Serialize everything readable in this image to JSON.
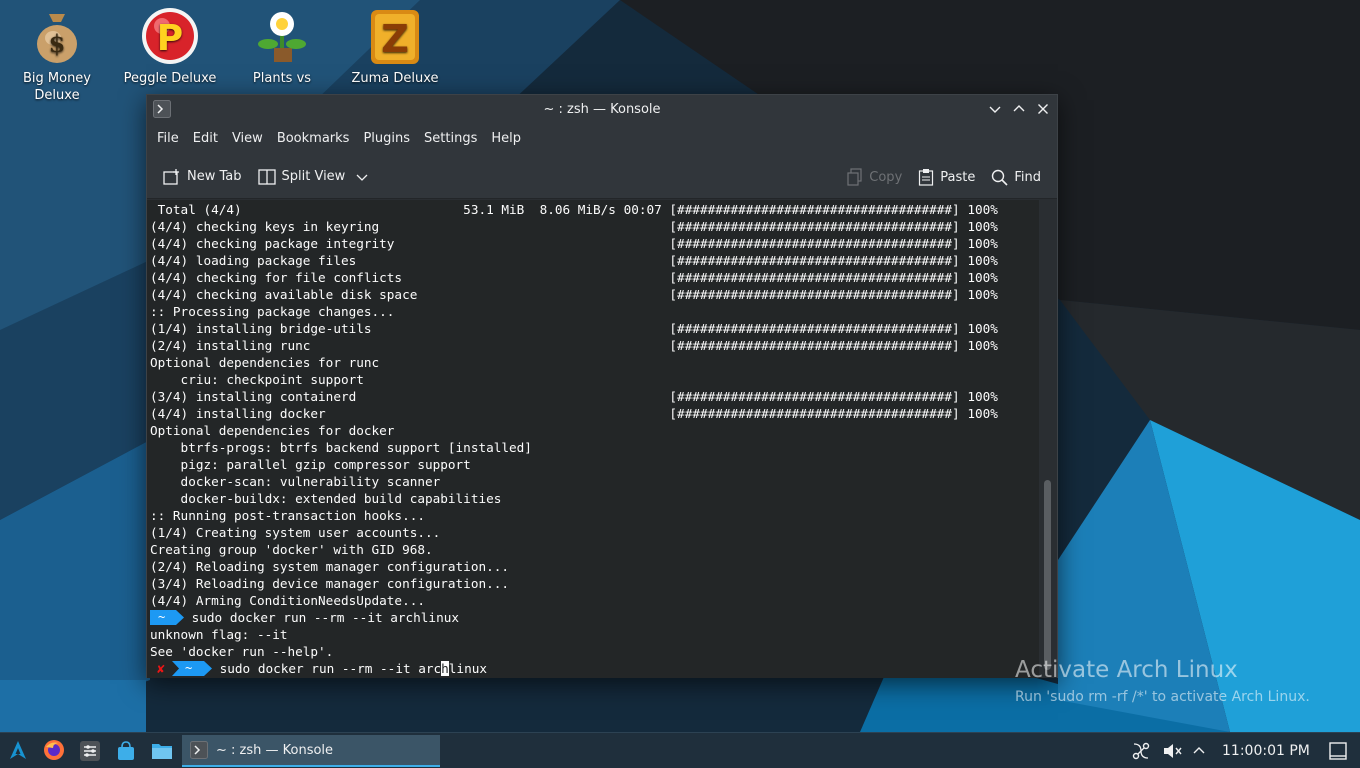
{
  "desktop_icons": [
    {
      "label": "Big Money Deluxe",
      "icon": "money-bag-icon"
    },
    {
      "label": "Peggle Deluxe",
      "icon": "peggle-icon"
    },
    {
      "label": "Plants vs",
      "icon": "plants-icon"
    },
    {
      "label": "Zuma Deluxe",
      "icon": "zuma-icon"
    }
  ],
  "window": {
    "title": "~ : zsh — Konsole",
    "menu": [
      "File",
      "Edit",
      "View",
      "Bookmarks",
      "Plugins",
      "Settings",
      "Help"
    ],
    "toolbar": {
      "new_tab": "New Tab",
      "split_view": "Split View",
      "copy": "Copy",
      "paste": "Paste",
      "find": "Find"
    }
  },
  "terminal": {
    "lines": [
      " Total (4/4)                             53.1 MiB  8.06 MiB/s 00:07 [####################################] 100%",
      "(4/4) checking keys in keyring                                      [####################################] 100%",
      "(4/4) checking package integrity                                    [####################################] 100%",
      "(4/4) loading package files                                         [####################################] 100%",
      "(4/4) checking for file conflicts                                   [####################################] 100%",
      "(4/4) checking available disk space                                 [####################################] 100%",
      ":: Processing package changes...",
      "(1/4) installing bridge-utils                                       [####################################] 100%",
      "(2/4) installing runc                                               [####################################] 100%",
      "Optional dependencies for runc",
      "    criu: checkpoint support",
      "(3/4) installing containerd                                         [####################################] 100%",
      "(4/4) installing docker                                             [####################################] 100%",
      "Optional dependencies for docker",
      "    btrfs-progs: btrfs backend support [installed]",
      "    pigz: parallel gzip compressor support",
      "    docker-scan: vulnerability scanner",
      "    docker-buildx: extended build capabilities",
      ":: Running post-transaction hooks...",
      "(1/4) Creating system user accounts...",
      "Creating group 'docker' with GID 968.",
      "(2/4) Reloading system manager configuration...",
      "(3/4) Reloading device manager configuration...",
      "(4/4) Arming ConditionNeedsUpdate..."
    ],
    "prompt_symbol": "~",
    "command1": " sudo docker run --rm --it archlinux",
    "error_line1": "unknown flag: --it",
    "error_line2": "See 'docker run --help'.",
    "error_mark": "✘",
    "command2_before_cursor": " sudo docker run --rm --it arc",
    "cursor_char": "h",
    "command2_after_cursor": "linux"
  },
  "watermark": {
    "title": "Activate Arch Linux",
    "subtitle": "Run 'sudo rm -rf /*' to activate Arch Linux."
  },
  "taskbar": {
    "task_title": "~ : zsh — Konsole",
    "clock": "11:00:01 PM"
  },
  "colors": {
    "accent": "#1d99f3",
    "terminal_bg": "#232627",
    "error": "#ed1515"
  }
}
